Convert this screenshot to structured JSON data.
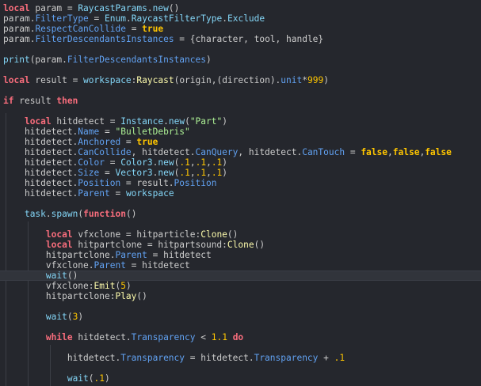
{
  "colors": {
    "background": "#25272d",
    "current_line": "#31343b",
    "keyword": "#f86d7c",
    "builtin": "#84d6f7",
    "property": "#61a1f1",
    "method": "#fdfbac",
    "string": "#adf195",
    "number": "#ffc600",
    "text": "#cccccc"
  },
  "editor": {
    "current_line_text": "wait()",
    "lines": [
      [
        {
          "t": "local",
          "k": "keyword"
        },
        {
          "t": " param = ",
          "k": "ident"
        },
        {
          "t": "RaycastParams",
          "k": "builtin"
        },
        {
          "t": ".",
          "k": "op"
        },
        {
          "t": "new",
          "k": "builtin"
        },
        {
          "t": "()",
          "k": "op"
        }
      ],
      [
        {
          "t": "param",
          "k": "ident"
        },
        {
          "t": ".",
          "k": "op"
        },
        {
          "t": "FilterType",
          "k": "prop"
        },
        {
          "t": " = ",
          "k": "op"
        },
        {
          "t": "Enum",
          "k": "builtin"
        },
        {
          "t": ".",
          "k": "op"
        },
        {
          "t": "RaycastFilterType",
          "k": "builtin"
        },
        {
          "t": ".",
          "k": "op"
        },
        {
          "t": "Exclude",
          "k": "builtin"
        }
      ],
      [
        {
          "t": "param",
          "k": "ident"
        },
        {
          "t": ".",
          "k": "op"
        },
        {
          "t": "RespectCanCollide",
          "k": "prop"
        },
        {
          "t": " = ",
          "k": "op"
        },
        {
          "t": "true",
          "k": "bool"
        }
      ],
      [
        {
          "t": "param",
          "k": "ident"
        },
        {
          "t": ".",
          "k": "op"
        },
        {
          "t": "FilterDescendantsInstances",
          "k": "prop"
        },
        {
          "t": " = {character, tool, handle}",
          "k": "ident"
        }
      ],
      [],
      [
        {
          "t": "print",
          "k": "builtin"
        },
        {
          "t": "(param.",
          "k": "ident"
        },
        {
          "t": "FilterDescendantsInstances",
          "k": "prop"
        },
        {
          "t": ")",
          "k": "op"
        }
      ],
      [],
      [
        {
          "t": "local",
          "k": "keyword"
        },
        {
          "t": " result = ",
          "k": "ident"
        },
        {
          "t": "workspace",
          "k": "builtin"
        },
        {
          "t": ":",
          "k": "op"
        },
        {
          "t": "Raycast",
          "k": "method"
        },
        {
          "t": "(origin,(direction).",
          "k": "ident"
        },
        {
          "t": "unit",
          "k": "prop"
        },
        {
          "t": "*",
          "k": "op"
        },
        {
          "t": "999",
          "k": "number"
        },
        {
          "t": ")",
          "k": "op"
        }
      ],
      [],
      [
        {
          "t": "if",
          "k": "keyword"
        },
        {
          "t": " result ",
          "k": "ident"
        },
        {
          "t": "then",
          "k": "keyword"
        }
      ],
      [],
      [
        {
          "t": "    ",
          "k": "ident"
        },
        {
          "t": "local",
          "k": "keyword"
        },
        {
          "t": " hitdetect = ",
          "k": "ident"
        },
        {
          "t": "Instance",
          "k": "builtin"
        },
        {
          "t": ".",
          "k": "op"
        },
        {
          "t": "new",
          "k": "builtin"
        },
        {
          "t": "(",
          "k": "op"
        },
        {
          "t": "\"Part\"",
          "k": "string"
        },
        {
          "t": ")",
          "k": "op"
        }
      ],
      [
        {
          "t": "    hitdetect.",
          "k": "ident"
        },
        {
          "t": "Name",
          "k": "prop"
        },
        {
          "t": " = ",
          "k": "op"
        },
        {
          "t": "\"BulletDebris\"",
          "k": "string"
        }
      ],
      [
        {
          "t": "    hitdetect.",
          "k": "ident"
        },
        {
          "t": "Anchored",
          "k": "prop"
        },
        {
          "t": " = ",
          "k": "op"
        },
        {
          "t": "true",
          "k": "bool"
        }
      ],
      [
        {
          "t": "    hitdetect.",
          "k": "ident"
        },
        {
          "t": "CanCollide",
          "k": "prop"
        },
        {
          "t": ", hitdetect.",
          "k": "ident"
        },
        {
          "t": "CanQuery",
          "k": "prop"
        },
        {
          "t": ", hitdetect.",
          "k": "ident"
        },
        {
          "t": "CanTouch",
          "k": "prop"
        },
        {
          "t": " = ",
          "k": "op"
        },
        {
          "t": "false",
          "k": "bool"
        },
        {
          "t": ",",
          "k": "op"
        },
        {
          "t": "false",
          "k": "bool"
        },
        {
          "t": ",",
          "k": "op"
        },
        {
          "t": "false",
          "k": "bool"
        }
      ],
      [
        {
          "t": "    hitdetect.",
          "k": "ident"
        },
        {
          "t": "Color",
          "k": "prop"
        },
        {
          "t": " = ",
          "k": "op"
        },
        {
          "t": "Color3",
          "k": "builtin"
        },
        {
          "t": ".",
          "k": "op"
        },
        {
          "t": "new",
          "k": "builtin"
        },
        {
          "t": "(",
          "k": "op"
        },
        {
          "t": ".1",
          "k": "number"
        },
        {
          "t": ",",
          "k": "op"
        },
        {
          "t": ".1",
          "k": "number"
        },
        {
          "t": ",",
          "k": "op"
        },
        {
          "t": ".1",
          "k": "number"
        },
        {
          "t": ")",
          "k": "op"
        }
      ],
      [
        {
          "t": "    hitdetect.",
          "k": "ident"
        },
        {
          "t": "Size",
          "k": "prop"
        },
        {
          "t": " = ",
          "k": "op"
        },
        {
          "t": "Vector3",
          "k": "builtin"
        },
        {
          "t": ".",
          "k": "op"
        },
        {
          "t": "new",
          "k": "builtin"
        },
        {
          "t": "(",
          "k": "op"
        },
        {
          "t": ".1",
          "k": "number"
        },
        {
          "t": ",",
          "k": "op"
        },
        {
          "t": ".1",
          "k": "number"
        },
        {
          "t": ",",
          "k": "op"
        },
        {
          "t": ".1",
          "k": "number"
        },
        {
          "t": ")",
          "k": "op"
        }
      ],
      [
        {
          "t": "    hitdetect.",
          "k": "ident"
        },
        {
          "t": "Position",
          "k": "prop"
        },
        {
          "t": " = result.",
          "k": "ident"
        },
        {
          "t": "Position",
          "k": "prop"
        }
      ],
      [
        {
          "t": "    hitdetect.",
          "k": "ident"
        },
        {
          "t": "Parent",
          "k": "prop"
        },
        {
          "t": " = ",
          "k": "op"
        },
        {
          "t": "workspace",
          "k": "builtin"
        }
      ],
      [],
      [
        {
          "t": "    ",
          "k": "ident"
        },
        {
          "t": "task",
          "k": "builtin"
        },
        {
          "t": ".",
          "k": "op"
        },
        {
          "t": "spawn",
          "k": "builtin"
        },
        {
          "t": "(",
          "k": "op"
        },
        {
          "t": "function",
          "k": "keyword"
        },
        {
          "t": "()",
          "k": "op"
        }
      ],
      [],
      [
        {
          "t": "        ",
          "k": "ident"
        },
        {
          "t": "local",
          "k": "keyword"
        },
        {
          "t": " vfxclone = hitparticle:",
          "k": "ident"
        },
        {
          "t": "Clone",
          "k": "method"
        },
        {
          "t": "()",
          "k": "op"
        }
      ],
      [
        {
          "t": "        ",
          "k": "ident"
        },
        {
          "t": "local",
          "k": "keyword"
        },
        {
          "t": " hitpartclone = hitpartsound:",
          "k": "ident"
        },
        {
          "t": "Clone",
          "k": "method"
        },
        {
          "t": "()",
          "k": "op"
        }
      ],
      [
        {
          "t": "        hitpartclone.",
          "k": "ident"
        },
        {
          "t": "Parent",
          "k": "prop"
        },
        {
          "t": " = hitdetect",
          "k": "ident"
        }
      ],
      [
        {
          "t": "        vfxclone.",
          "k": "ident"
        },
        {
          "t": "Parent",
          "k": "prop"
        },
        {
          "t": " = hitdetect",
          "k": "ident"
        }
      ],
      [
        {
          "t": "        ",
          "k": "ident"
        },
        {
          "t": "wait",
          "k": "builtin"
        },
        {
          "t": "()",
          "k": "op"
        }
      ],
      [
        {
          "t": "        vfxclone:",
          "k": "ident"
        },
        {
          "t": "Emit",
          "k": "method"
        },
        {
          "t": "(",
          "k": "op"
        },
        {
          "t": "5",
          "k": "number"
        },
        {
          "t": ")",
          "k": "op"
        }
      ],
      [
        {
          "t": "        hitpartclone:",
          "k": "ident"
        },
        {
          "t": "Play",
          "k": "method"
        },
        {
          "t": "()",
          "k": "op"
        }
      ],
      [],
      [
        {
          "t": "        ",
          "k": "ident"
        },
        {
          "t": "wait",
          "k": "builtin"
        },
        {
          "t": "(",
          "k": "op"
        },
        {
          "t": "3",
          "k": "number"
        },
        {
          "t": ")",
          "k": "op"
        }
      ],
      [],
      [
        {
          "t": "        ",
          "k": "ident"
        },
        {
          "t": "while",
          "k": "keyword"
        },
        {
          "t": " hitdetect.",
          "k": "ident"
        },
        {
          "t": "Transparency",
          "k": "prop"
        },
        {
          "t": " < ",
          "k": "op"
        },
        {
          "t": "1.1",
          "k": "number"
        },
        {
          "t": " ",
          "k": "op"
        },
        {
          "t": "do",
          "k": "keyword"
        }
      ],
      [],
      [
        {
          "t": "            hitdetect.",
          "k": "ident"
        },
        {
          "t": "Transparency",
          "k": "prop"
        },
        {
          "t": " = hitdetect.",
          "k": "ident"
        },
        {
          "t": "Transparency",
          "k": "prop"
        },
        {
          "t": " + ",
          "k": "op"
        },
        {
          "t": ".1",
          "k": "number"
        }
      ],
      [],
      [
        {
          "t": "            ",
          "k": "ident"
        },
        {
          "t": "wait",
          "k": "builtin"
        },
        {
          "t": "(",
          "k": "op"
        },
        {
          "t": ".1",
          "k": "number"
        },
        {
          "t": ")",
          "k": "op"
        }
      ]
    ]
  }
}
